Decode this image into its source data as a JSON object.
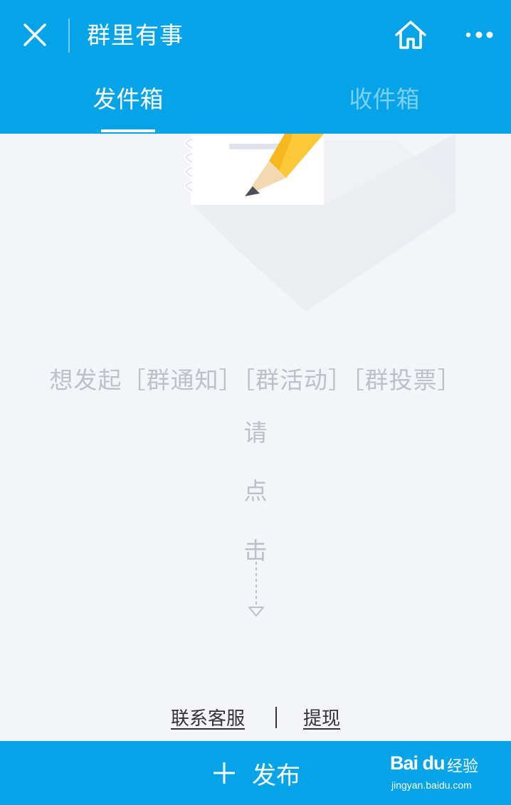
{
  "header": {
    "title": "群里有事",
    "close_icon": "close-icon",
    "home_icon": "home-icon",
    "more_icon": "more-dots-icon"
  },
  "tabs": [
    {
      "label": "发件箱",
      "active": true
    },
    {
      "label": "收件箱",
      "active": false
    }
  ],
  "empty_state": {
    "illustration_icon": "notebook-pencil-icon",
    "prompt": "想发起［群通知］［群活动］［群投票］",
    "vertical_hint": [
      "请",
      "点",
      "击"
    ],
    "arrow_icon": "dashed-arrow-down-icon"
  },
  "footer_links": {
    "contact": "联系客服",
    "withdraw": "提现"
  },
  "bottom_bar": {
    "publish_label": "发布",
    "plus_icon": "plus-icon"
  },
  "watermark": {
    "logo": "Bai du",
    "name": "经验",
    "url": "jingyan.baidu.com"
  },
  "colors": {
    "brand": "#05a3e8",
    "background": "#f4f5f9",
    "muted_text": "#bcc0c9",
    "inactive_tab": "#7ed0f3"
  }
}
